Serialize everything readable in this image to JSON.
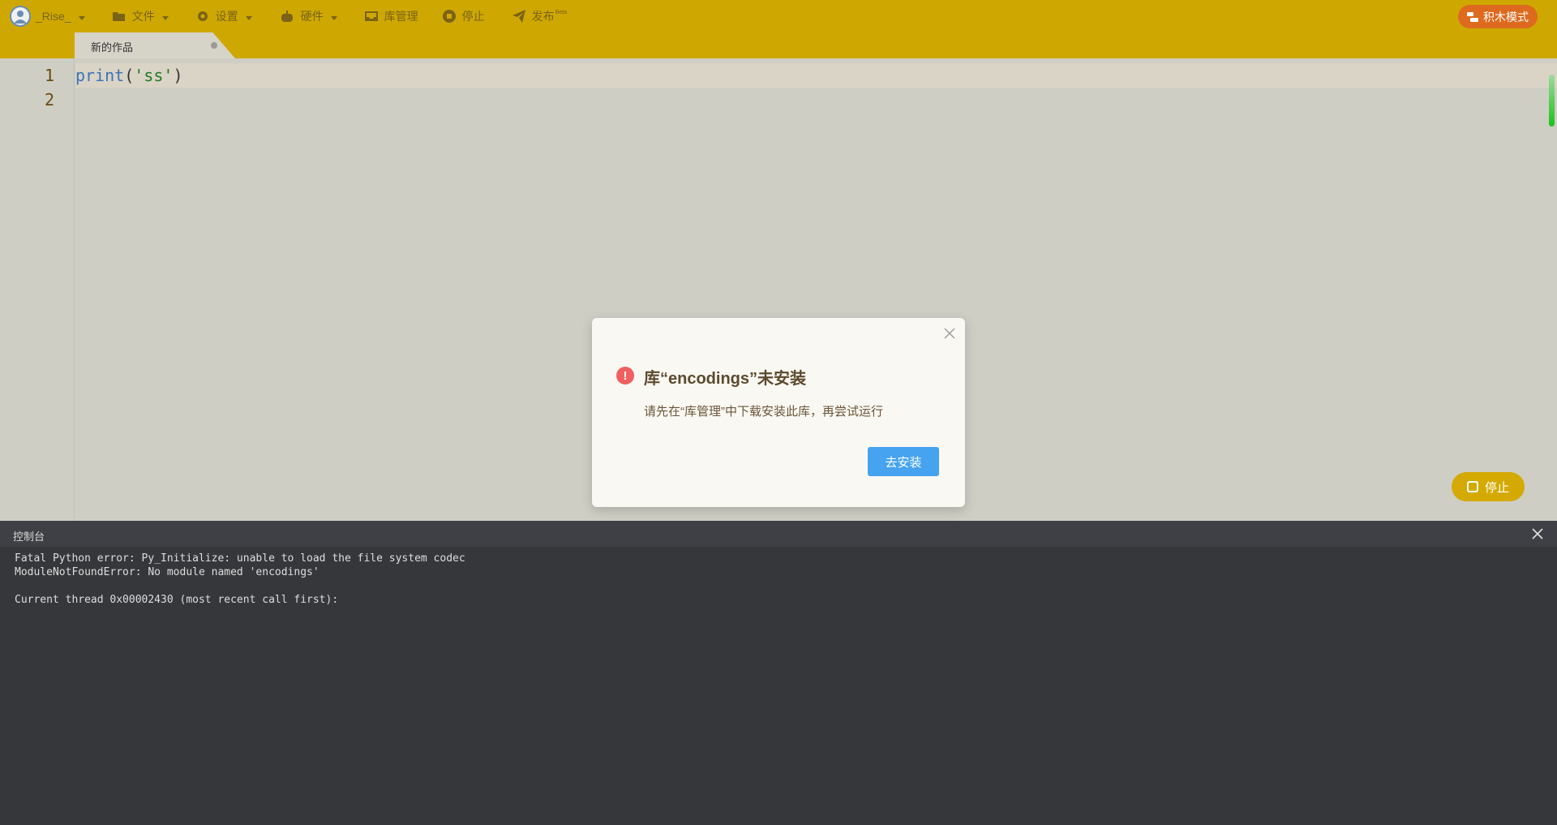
{
  "menubar": {
    "user_label": "_Rise_",
    "file_label": "文件",
    "settings_label": "设置",
    "hardware_label": "硬件",
    "library_label": "库管理",
    "stop_label": "停止",
    "publish_label": "发布",
    "publish_badge": "Beta",
    "mode_label": "积木模式",
    "colors": {
      "bar": "#cea800",
      "mode_button": "#dd6a1e"
    }
  },
  "tabs": [
    {
      "label": "新的作品"
    }
  ],
  "editor": {
    "line_numbers": [
      "1",
      "2"
    ],
    "code": {
      "fn": "print",
      "open": "(",
      "string": "'ss'",
      "close": ")"
    }
  },
  "run_control": {
    "stop_label": "停止"
  },
  "console": {
    "title": "控制台",
    "output": "Fatal Python error: Py_Initialize: unable to load the file system codec\nModuleNotFoundError: No module named 'encodings'\n\nCurrent thread 0x00002430 (most recent call first):"
  },
  "modal": {
    "title": "库“encodings”未安装",
    "message": "请先在“库管理”中下载安装此库，再尝试运行",
    "button_label": "去安装",
    "icon": "exclamation-icon",
    "colors": {
      "icon": "#f06060",
      "button": "#45a3f0"
    }
  }
}
